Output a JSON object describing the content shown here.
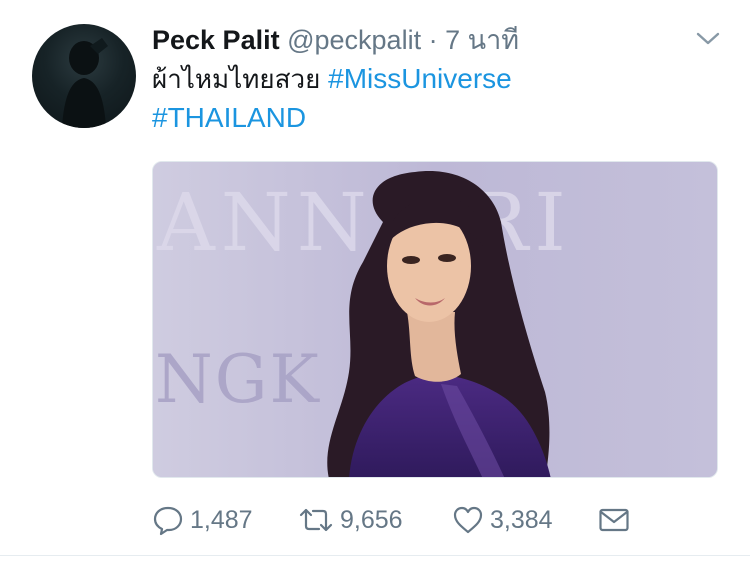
{
  "tweet": {
    "author_name": "Peck Palit",
    "author_handle": "@peckpalit",
    "separator": "·",
    "timestamp": "7 นาที",
    "text": "ผ้าไหมไทยสวย",
    "hashtags": [
      "#MissUniverse",
      "#THAILAND"
    ],
    "media": {
      "backdrop_text_top": "ANNA  RI",
      "backdrop_text_bottom": "NGK"
    }
  },
  "actions": {
    "reply_count": "1,487",
    "retweet_count": "9,656",
    "like_count": "3,384"
  },
  "icons": {
    "menu": "chevron-down-icon",
    "reply": "reply-icon",
    "retweet": "retweet-icon",
    "like": "heart-icon",
    "dm": "envelope-icon"
  },
  "colors": {
    "name": "#14171a",
    "secondary": "#657786",
    "link": "#1b95e0",
    "divider": "#e6ecf0"
  }
}
